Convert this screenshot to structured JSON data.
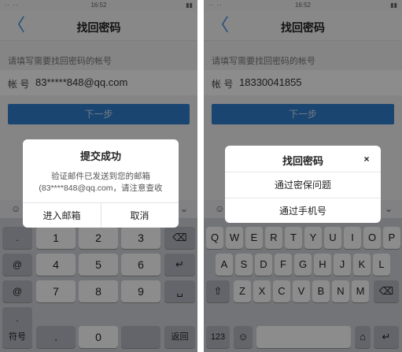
{
  "left": {
    "status": {
      "left": "·· ··",
      "time": "16:52",
      "right": "▮▮"
    },
    "title": "找回密码",
    "back": "〈",
    "hint": "请填写需要找回密码的帐号",
    "account_label": "帐 号",
    "account_value": "83*****848@qq.com",
    "next_button": "下一步",
    "dialog": {
      "title": "提交成功",
      "message_line1": "验证邮件已发送到您的邮箱",
      "message_line2": "(83****848@qq.com，请注意查收",
      "btn_left": "进入邮箱",
      "btn_right": "取消"
    },
    "keys": {
      "k1": "1",
      "k2": "2",
      "k3": "3",
      "k4": "4",
      "k5": "5",
      "k6": "6",
      "k7": "7",
      "k8": "8",
      "k9": "9",
      "k0": "0",
      "sym": "符号",
      "ret": "返回",
      "dot": ".",
      "at": "@",
      "at2": "@"
    }
  },
  "right": {
    "status": {
      "left": "·· ··",
      "time": "16:52",
      "right": "▮▮"
    },
    "title": "找回密码",
    "back": "〈",
    "hint": "请填写需要找回密码的帐号",
    "account_label": "帐 号",
    "account_value": "18330041855",
    "next_button": "下一步",
    "dialog": {
      "title": "找回密码",
      "close": "×",
      "option1": "通过密保问题",
      "option2": "通过手机号"
    },
    "keys": {
      "row1": [
        "Q",
        "W",
        "E",
        "R",
        "T",
        "Y",
        "U",
        "I",
        "O",
        "P"
      ],
      "row2": [
        "A",
        "S",
        "D",
        "F",
        "G",
        "H",
        "J",
        "K",
        "L"
      ],
      "row3": [
        "Z",
        "X",
        "C",
        "V",
        "B",
        "N",
        "M"
      ],
      "num": "123"
    }
  }
}
